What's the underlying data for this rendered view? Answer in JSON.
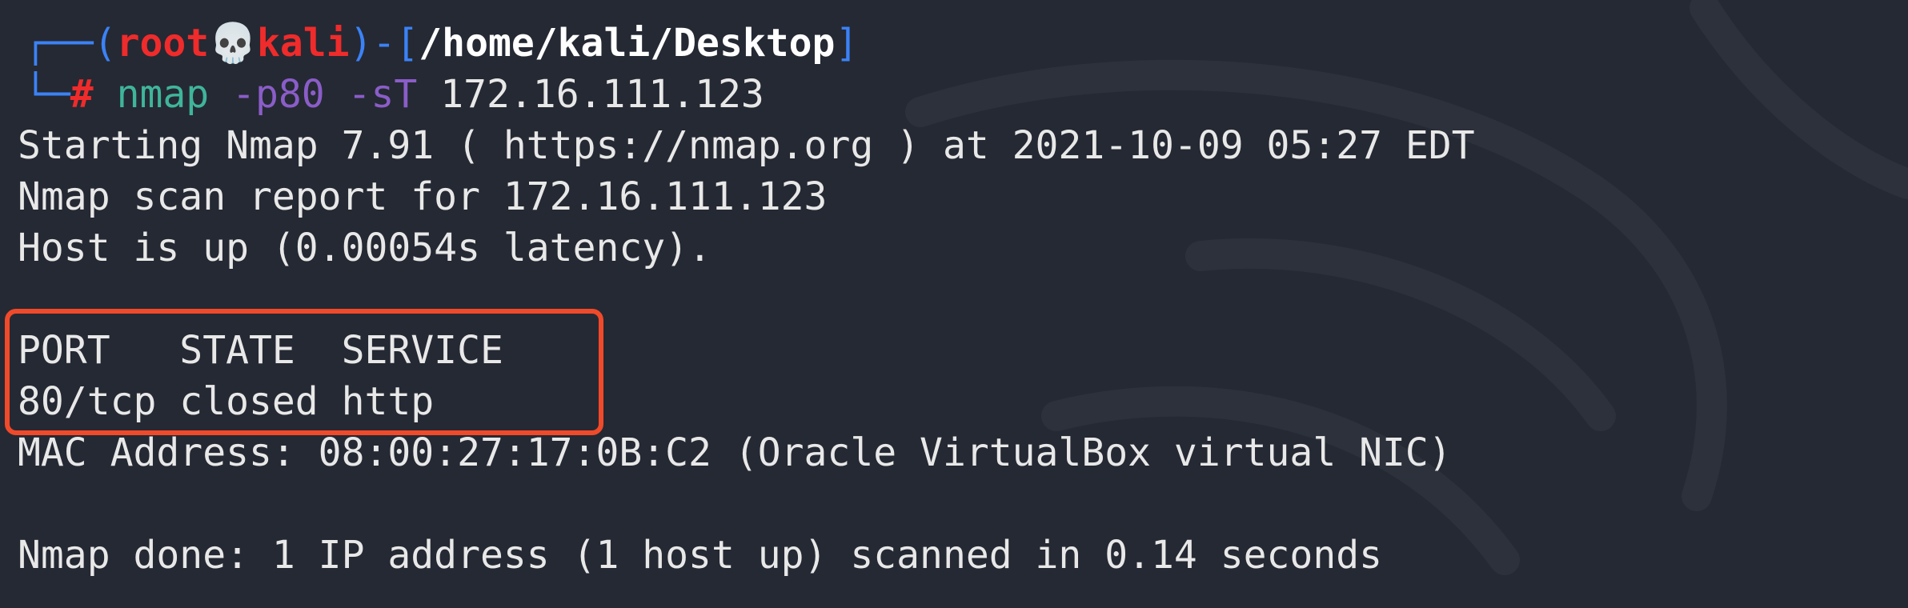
{
  "prompt": {
    "open_bracket": "(",
    "user": "root",
    "skull": "💀",
    "host": "kali",
    "separator": ")-[",
    "path": "/home/kali/Desktop",
    "close_bracket": "]",
    "symbol": "#",
    "command_name": "nmap",
    "command_flags": "-p80 -sT",
    "command_target": "172.16.111.123"
  },
  "output": {
    "line_start": "Starting Nmap 7.91 ( https://nmap.org ) at 2021-10-09 05:27 EDT",
    "line_report": "Nmap scan report for 172.16.111.123",
    "line_host": "Host is up (0.00054s latency).",
    "table_header": "PORT   STATE  SERVICE",
    "table_row": "80/tcp closed http",
    "line_mac": "MAC Address: 08:00:27:17:0B:C2 (Oracle VirtualBox virtual NIC)",
    "line_done": "Nmap done: 1 IP address (1 host up) scanned in 0.14 seconds"
  },
  "colors": {
    "background": "#252933",
    "text": "#e8e8e8",
    "prompt_red": "#ef2b2b",
    "prompt_blue": "#3b82f6",
    "command_teal": "#3fb59b",
    "flag_purple": "#8a5dc8",
    "highlight_border": "#f04a2a"
  }
}
